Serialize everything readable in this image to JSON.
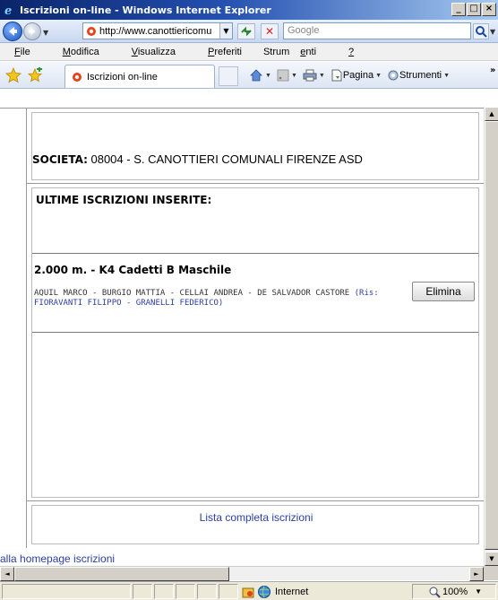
{
  "window": {
    "title": "Iscrizioni on-line - Windows Internet Explorer",
    "buttons": [
      "_",
      "□",
      "×"
    ]
  },
  "navigation": {
    "url": "http://www.canottiericomu",
    "search_placeholder": "Google"
  },
  "menu": {
    "items": [
      {
        "prefix": "",
        "underlined": "F",
        "rest": "ile"
      },
      {
        "prefix": "",
        "underlined": "M",
        "rest": "odifica"
      },
      {
        "prefix": "",
        "underlined": "V",
        "rest": "isualizza"
      },
      {
        "prefix": "",
        "underlined": "P",
        "rest": "referiti"
      },
      {
        "prefix": "Strum",
        "underlined": "e",
        "rest": "nti"
      },
      {
        "prefix": "",
        "underlined": "?",
        "rest": ""
      }
    ]
  },
  "tab": {
    "label": "Iscrizioni on-line"
  },
  "commandbar": {
    "page_label": "Pagina",
    "tools_label": "Strumenti"
  },
  "content": {
    "societa_label": "SOCIETA:",
    "societa_value": " 08004 - S. CANOTTIERI COMUNALI FIRENZE ASD",
    "ultime_title": "ULTIME ISCRIZIONI INSERITE:",
    "entry": {
      "race": "2.000 m. - K4 Cadetti B Maschile",
      "athletes": "AQUIL MARCO - BURGIO MATTIA - CELLAI ANDREA - DE SALVADOR CASTORE",
      "reserves": "(Ris: FIORAVANTI FILIPPO - GRANELLI FEDERICO)",
      "delete_label": "Elimina"
    },
    "full_list_link": "Lista completa iscrizioni",
    "home_link": "alla homepage iscrizioni"
  },
  "status": {
    "zone": "Internet",
    "zoom": "100%"
  },
  "colors": {
    "link": "#2c3fa0",
    "titlebar_start": "#0a246a"
  }
}
